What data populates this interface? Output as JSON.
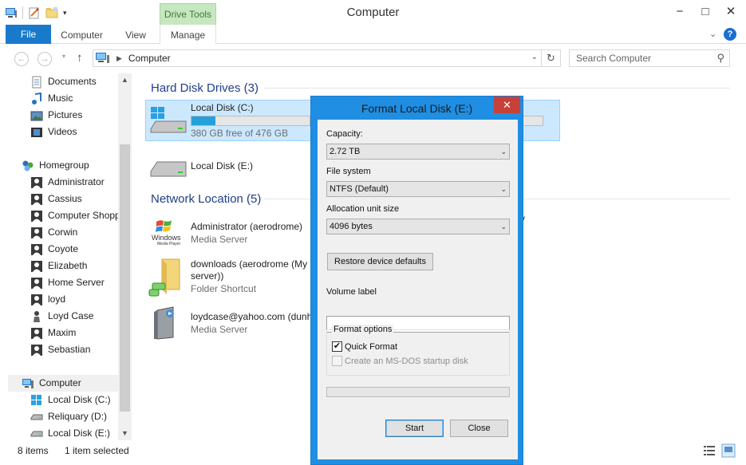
{
  "window": {
    "title": "Computer",
    "context_tab": "Drive Tools",
    "controls": [
      "−",
      "□",
      "✕"
    ]
  },
  "ribbon": {
    "tabs": [
      "File",
      "Computer",
      "View",
      "Manage"
    ],
    "help": "?"
  },
  "address": {
    "path": "Computer",
    "search_placeholder": "Search Computer"
  },
  "nav": {
    "items": [
      {
        "label": "Documents",
        "icon": "documents-icon"
      },
      {
        "label": "Music",
        "icon": "music-icon"
      },
      {
        "label": "Pictures",
        "icon": "pictures-icon"
      },
      {
        "label": "Videos",
        "icon": "videos-icon"
      },
      {
        "label": "Homegroup",
        "icon": "homegroup-icon"
      },
      {
        "label": "Administrator",
        "icon": "user-icon"
      },
      {
        "label": "Cassius",
        "icon": "user-icon"
      },
      {
        "label": "Computer Shopper",
        "icon": "user-icon"
      },
      {
        "label": "Corwin",
        "icon": "user-icon"
      },
      {
        "label": "Coyote",
        "icon": "user-icon"
      },
      {
        "label": "Elizabeth",
        "icon": "user-icon"
      },
      {
        "label": "Home Server",
        "icon": "user-icon"
      },
      {
        "label": "loyd",
        "icon": "user-icon"
      },
      {
        "label": "Loyd Case",
        "icon": "user-icon"
      },
      {
        "label": "Maxim",
        "icon": "user-icon"
      },
      {
        "label": "Sebastian",
        "icon": "user-icon"
      },
      {
        "label": "Computer",
        "icon": "computer-icon"
      },
      {
        "label": "Local Disk (C:)",
        "icon": "windows-drive-icon"
      },
      {
        "label": "Reliquary (D:)",
        "icon": "drive-icon"
      },
      {
        "label": "Local Disk (E:)",
        "icon": "drive-icon"
      }
    ]
  },
  "content": {
    "hard_disk_header": "Hard Disk Drives (3)",
    "network_header": "Network Location (5)",
    "drives": [
      {
        "name": "Local Disk (C:)",
        "free": "380 GB free of 476 GB",
        "used_fraction": 0.2
      },
      {
        "name": "Local Disk (E:)"
      }
    ],
    "network": [
      {
        "name": "Administrator (aerodrome)",
        "sub": "Media Server",
        "icon_text_1": "Windows",
        "icon_text_2": "Media Player"
      },
      {
        "name": "downloads (aerodrome (My",
        "name2": "server))",
        "sub": "Folder Shortcut"
      },
      {
        "name": "loydcase@yahoo.com (dunh",
        "sub": "Media Server"
      }
    ],
    "truncated_glyph": "y"
  },
  "status": {
    "items": "8 items",
    "selected": "1 item selected"
  },
  "dialog": {
    "title": "Format Local Disk (E:)",
    "capacity_label": "Capacity:",
    "capacity_value": "2.72 TB",
    "fs_label": "File system",
    "fs_value": "NTFS (Default)",
    "alloc_label": "Allocation unit size",
    "alloc_value": "4096 bytes",
    "restore_button": "Restore device defaults",
    "volume_label": "Volume label",
    "volume_value": "",
    "options_legend": "Format options",
    "quick_format": "Quick Format",
    "quick_format_checked": true,
    "msdos": "Create an MS-DOS startup disk",
    "progress_fraction": 0,
    "start_button": "Start",
    "close_button": "Close"
  }
}
